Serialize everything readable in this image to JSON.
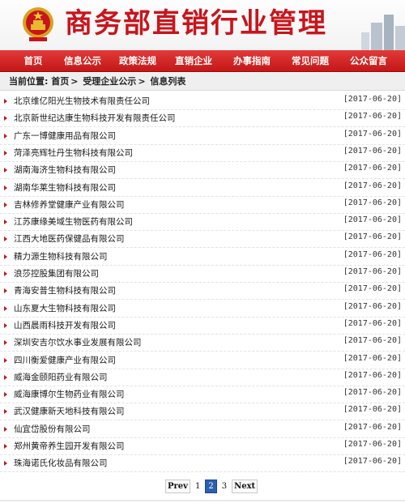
{
  "header": {
    "title": "商务部直销行业管理",
    "emblem_icon": "national-emblem-icon",
    "brand_color": "#c8151c"
  },
  "nav": {
    "items": [
      {
        "label": "首页"
      },
      {
        "label": "信息公示"
      },
      {
        "label": "政策法规"
      },
      {
        "label": "直销企业"
      },
      {
        "label": "办事指南"
      },
      {
        "label": "常见问题"
      },
      {
        "label": "公众留言"
      }
    ]
  },
  "breadcrumb": {
    "prefix": "当前位置:",
    "items": [
      "首页",
      "受理企业公示",
      "信息列表"
    ],
    "separator": ">"
  },
  "list": {
    "rows": [
      {
        "title": "北京维亿阳光生物技术有限责任公司",
        "date": "[2017-06-20]"
      },
      {
        "title": "北京新世纪达康生物科技开发有限责任公司",
        "date": "[2017-06-20]"
      },
      {
        "title": "广东一博健康用品有限公司",
        "date": "[2017-06-20]"
      },
      {
        "title": "菏泽亮辉牡丹生物科技有限公司",
        "date": "[2017-06-20]"
      },
      {
        "title": "湖南海济生物科技有限公司",
        "date": "[2017-06-20]"
      },
      {
        "title": "湖南华莱生物科技有限公司",
        "date": "[2017-06-20]"
      },
      {
        "title": "吉林修养堂健康产业有限公司",
        "date": "[2017-06-20]"
      },
      {
        "title": "江苏康缘美域生物医药有限公司",
        "date": "[2017-06-20]"
      },
      {
        "title": "江西大地医药保健品有限公司",
        "date": "[2017-06-20]"
      },
      {
        "title": "精力源生物科技有限公司",
        "date": "[2017-06-20]"
      },
      {
        "title": "浪莎控股集团有限公司",
        "date": "[2017-06-20]"
      },
      {
        "title": "青海安普生物科技有限公司",
        "date": "[2017-06-20]"
      },
      {
        "title": "山东夏大生物科技有限公司",
        "date": "[2017-06-20]"
      },
      {
        "title": "山西晨雨科技开发有限公司",
        "date": "[2017-06-20]"
      },
      {
        "title": "深圳安吉尔饮水事业发展有限公司",
        "date": "[2017-06-20]"
      },
      {
        "title": "四川衡爱健康产业有限公司",
        "date": "[2017-06-20]"
      },
      {
        "title": "威海金颐阳药业有限公司",
        "date": "[2017-06-20]"
      },
      {
        "title": "威海康博尔生物药业有限公司",
        "date": "[2017-06-20]"
      },
      {
        "title": "武汉健康新天地科技有限公司",
        "date": "[2017-06-20]"
      },
      {
        "title": "仙宜岱股份有限公司",
        "date": "[2017-06-20]"
      },
      {
        "title": "郑州黄帝养生园开发有限公司",
        "date": "[2017-06-20]"
      },
      {
        "title": "珠海诺氏化妆品有限公司",
        "date": "[2017-06-20]"
      }
    ]
  },
  "pagination": {
    "prev_label": "Prev",
    "pages": [
      "1",
      "2",
      "3"
    ],
    "current_page": "2",
    "next_label": "Next"
  }
}
